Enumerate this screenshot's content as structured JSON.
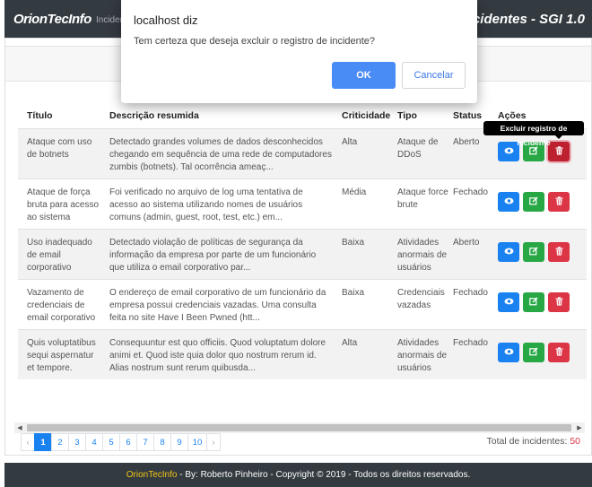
{
  "navbar": {
    "brand": "OrionTecInfo",
    "link": "Incidentes",
    "title": "Incidentes - SGI 1.0"
  },
  "table": {
    "headers": [
      "Título",
      "Descrição resumida",
      "Criticidade",
      "Tipo",
      "Status",
      "Ações"
    ],
    "rows": [
      {
        "title": "Ataque com uso de botnets",
        "description": "Detectado grandes volumes de dados desconhecidos chegando em sequência de uma rede de computadores zumbis (botnets). Tal ocorrência ameaç...",
        "criticality": "Alta",
        "type": "Ataque de DDoS",
        "status": "Aberto"
      },
      {
        "title": "Ataque de força bruta para acesso ao sistema",
        "description": "Foi verificado no arquivo de log uma tentativa de acesso ao sistema utilizando nomes de usuários comuns (admin, guest, root, test, etc.) em...",
        "criticality": "Média",
        "type": "Ataque force brute",
        "status": "Fechado"
      },
      {
        "title": "Uso inadequado de email corporativo",
        "description": "Detectado violação de políticas de segurança da informação da empresa por parte de um funcionário que utiliza o email corporativo par...",
        "criticality": "Baixa",
        "type": "Atividades anormais de usuários",
        "status": "Aberto"
      },
      {
        "title": "Vazamento de credenciais de email corporativo",
        "description": "O endereço de email corporativo de um funcionário da empresa possui credenciais vazadas. Uma consulta feita no site Have I Been Pwned (htt...",
        "criticality": "Baixa",
        "type": "Credenciais vazadas",
        "status": "Fechado"
      },
      {
        "title": "Quis voluptatibus sequi aspernatur et tempore.",
        "description": "Consequuntur est quo officiis. Quod voluptatum dolore animi et. Quod iste quia dolor quo nostrum rerum id. Alias nostrum sunt rerum quibusda...",
        "criticality": "Alta",
        "type": "Atividades anormais de usuários",
        "status": "Fechado"
      }
    ],
    "action_icons": {
      "view": "eye-icon",
      "edit": "edit-icon",
      "delete": "trash-icon"
    },
    "tooltip": "Excluir registro de incidente"
  },
  "pagination": {
    "prev": "‹",
    "pages": [
      "1",
      "2",
      "3",
      "4",
      "5",
      "6",
      "7",
      "8",
      "9",
      "10"
    ],
    "next": "›",
    "current": "1"
  },
  "total": {
    "label": "Total de incidentes:",
    "value": "50"
  },
  "footer": {
    "brand": "OrionTecInfo",
    "text": " - By: Roberto Pinheiro - Copyright © 2019 - Todos os direitos reservados."
  },
  "dialog": {
    "title": "localhost diz",
    "message": "Tem certeza que deseja excluir o registro de incidente?",
    "ok": "OK",
    "cancel": "Cancelar"
  },
  "colors": {
    "navbar": "#333a40",
    "primary": "#1a82f0",
    "success": "#28a745",
    "danger": "#dc3545",
    "footer_brand": "#f0c419"
  }
}
